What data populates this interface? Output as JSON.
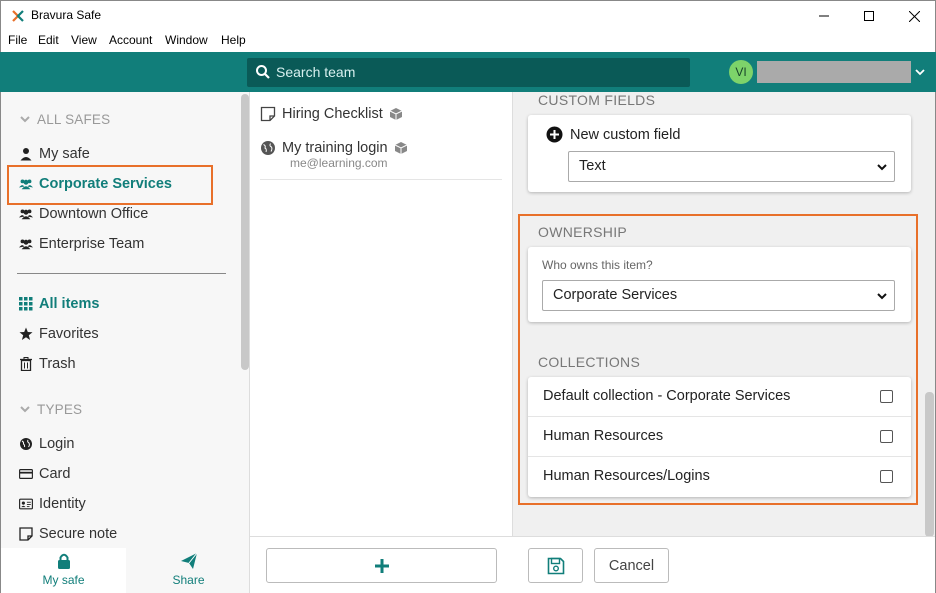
{
  "window": {
    "title": "Bravura Safe"
  },
  "menu": [
    "File",
    "Edit",
    "View",
    "Account",
    "Window",
    "Help"
  ],
  "topbar": {
    "search_placeholder": "Search team",
    "avatar_initials": "VI"
  },
  "sidebar": {
    "all_safes_label": "ALL SAFES",
    "safes": [
      {
        "label": "My safe",
        "icon": "user-icon"
      },
      {
        "label": "Corporate Services",
        "icon": "users-icon",
        "active": true
      },
      {
        "label": "Downtown Office",
        "icon": "users-icon"
      },
      {
        "label": "Enterprise Team",
        "icon": "users-icon"
      }
    ],
    "filters": [
      {
        "label": "All items",
        "icon": "grid-icon",
        "active": true
      },
      {
        "label": "Favorites",
        "icon": "star-icon"
      },
      {
        "label": "Trash",
        "icon": "trash-icon"
      }
    ],
    "types_label": "TYPES",
    "types": [
      {
        "label": "Login",
        "icon": "globe-icon"
      },
      {
        "label": "Card",
        "icon": "card-icon"
      },
      {
        "label": "Identity",
        "icon": "id-card-icon"
      },
      {
        "label": "Secure note",
        "icon": "note-icon"
      }
    ],
    "bottom_tabs": [
      {
        "label": "My safe",
        "icon": "lock-icon",
        "active": true
      },
      {
        "label": "Share",
        "icon": "send-icon"
      }
    ]
  },
  "items": [
    {
      "name": "Hiring Checklist",
      "sub": "",
      "icon": "note-icon"
    },
    {
      "name": "My training login",
      "sub": "me@learning.com",
      "icon": "globe-icon"
    }
  ],
  "detail": {
    "custom_fields_title": "CUSTOM FIELDS",
    "new_custom_field_label": "New custom field",
    "custom_field_type": "Text",
    "ownership_title": "OWNERSHIP",
    "owner_question": "Who owns this item?",
    "owner_value": "Corporate Services",
    "collections_title": "COLLECTIONS",
    "collections": [
      {
        "label": "Default collection - Corporate Services",
        "checked": false
      },
      {
        "label": "Human Resources",
        "checked": false
      },
      {
        "label": "Human Resources/Logins",
        "checked": false
      }
    ],
    "cancel_label": "Cancel"
  },
  "colors": {
    "teal": "#117e7a",
    "highlight": "#e8702a",
    "avatar": "#7dd36a"
  }
}
